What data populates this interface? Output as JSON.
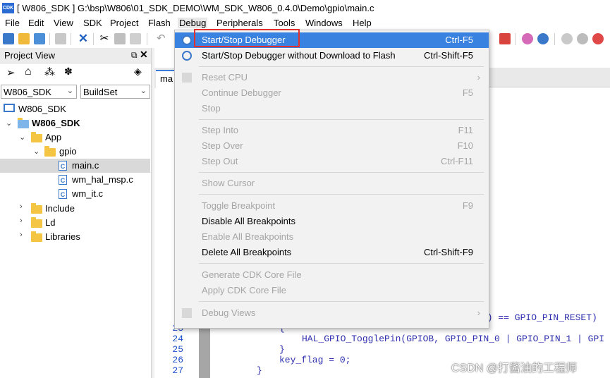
{
  "window": {
    "title": "[ W806_SDK ] G:\\bsp\\W806\\01_SDK_DEMO\\WM_SDK_W806_0.4.0\\Demo\\gpio\\main.c",
    "app_icon_text": "CDK"
  },
  "menubar": [
    "File",
    "Edit",
    "View",
    "SDK",
    "Project",
    "Flash",
    "Debug",
    "Peripherals",
    "Tools",
    "Windows",
    "Help"
  ],
  "project_view": {
    "title": "Project View",
    "project_combo": "W806_SDK",
    "buildset_combo": "BuildSet",
    "tree": [
      {
        "label": "W806_SDK"
      },
      {
        "label": "W806_SDK"
      },
      {
        "label": "App"
      },
      {
        "label": "gpio"
      },
      {
        "label": "main.c"
      },
      {
        "label": "wm_hal_msp.c"
      },
      {
        "label": "wm_it.c"
      },
      {
        "label": "Include"
      },
      {
        "label": "Ld"
      },
      {
        "label": "Libraries"
      }
    ]
  },
  "editor": {
    "tab_label": "ma",
    "line_numbers": [
      "23",
      "24",
      "25",
      "26",
      "27"
    ],
    "code_lines": [
      "5) == GPIO_PIN_RESET)",
      "{",
      "HAL_GPIO_TogglePin(GPIOB, GPIO_PIN_0 | GPIO_PIN_1 | GPI",
      "}",
      "key_flag = 0;",
      "}"
    ]
  },
  "debug_menu": {
    "items": [
      {
        "label": "Start/Stop Debugger",
        "shortcut": "Ctrl-F5",
        "enabled": true
      },
      {
        "label": "Start/Stop Debugger without Download to Flash",
        "shortcut": "Ctrl-Shift-F5",
        "enabled": true
      },
      {
        "label": "Reset CPU",
        "shortcut": "",
        "enabled": false
      },
      {
        "label": "Continue Debugger",
        "shortcut": "F5",
        "enabled": false
      },
      {
        "label": "Stop",
        "shortcut": "",
        "enabled": false
      },
      {
        "label": "Step Into",
        "shortcut": "F11",
        "enabled": false
      },
      {
        "label": "Step Over",
        "shortcut": "F10",
        "enabled": false
      },
      {
        "label": "Step Out",
        "shortcut": "Ctrl-F11",
        "enabled": false
      },
      {
        "label": "Show Cursor",
        "shortcut": "",
        "enabled": false
      },
      {
        "label": "Toggle Breakpoint",
        "shortcut": "F9",
        "enabled": false
      },
      {
        "label": "Disable All Breakpoints",
        "shortcut": "",
        "enabled": true
      },
      {
        "label": "Enable All Breakpoints",
        "shortcut": "",
        "enabled": false
      },
      {
        "label": "Delete All Breakpoints",
        "shortcut": "Ctrl-Shift-F9",
        "enabled": true
      },
      {
        "label": "Generate CDK Core File",
        "shortcut": "",
        "enabled": false
      },
      {
        "label": "Apply CDK Core File",
        "shortcut": "",
        "enabled": false
      },
      {
        "label": "Debug Views",
        "shortcut": "",
        "enabled": false
      }
    ]
  },
  "watermark": "CSDN @打酱油的工程师",
  "colors": {
    "selection": "#3a82e0",
    "highlight_box": "#e03030",
    "line_numbers": "#1c4fc9",
    "code": "#2f2fae"
  }
}
